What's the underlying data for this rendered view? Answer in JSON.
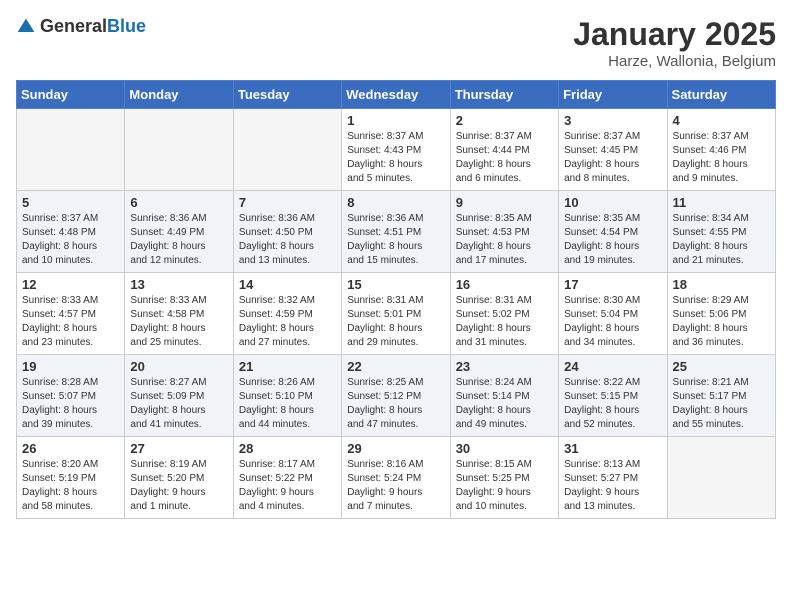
{
  "logo": {
    "text_general": "General",
    "text_blue": "Blue"
  },
  "header": {
    "month": "January 2025",
    "location": "Harze, Wallonia, Belgium"
  },
  "weekdays": [
    "Sunday",
    "Monday",
    "Tuesday",
    "Wednesday",
    "Thursday",
    "Friday",
    "Saturday"
  ],
  "weeks": [
    [
      {
        "day": "",
        "info": ""
      },
      {
        "day": "",
        "info": ""
      },
      {
        "day": "",
        "info": ""
      },
      {
        "day": "1",
        "info": "Sunrise: 8:37 AM\nSunset: 4:43 PM\nDaylight: 8 hours\nand 5 minutes."
      },
      {
        "day": "2",
        "info": "Sunrise: 8:37 AM\nSunset: 4:44 PM\nDaylight: 8 hours\nand 6 minutes."
      },
      {
        "day": "3",
        "info": "Sunrise: 8:37 AM\nSunset: 4:45 PM\nDaylight: 8 hours\nand 8 minutes."
      },
      {
        "day": "4",
        "info": "Sunrise: 8:37 AM\nSunset: 4:46 PM\nDaylight: 8 hours\nand 9 minutes."
      }
    ],
    [
      {
        "day": "5",
        "info": "Sunrise: 8:37 AM\nSunset: 4:48 PM\nDaylight: 8 hours\nand 10 minutes."
      },
      {
        "day": "6",
        "info": "Sunrise: 8:36 AM\nSunset: 4:49 PM\nDaylight: 8 hours\nand 12 minutes."
      },
      {
        "day": "7",
        "info": "Sunrise: 8:36 AM\nSunset: 4:50 PM\nDaylight: 8 hours\nand 13 minutes."
      },
      {
        "day": "8",
        "info": "Sunrise: 8:36 AM\nSunset: 4:51 PM\nDaylight: 8 hours\nand 15 minutes."
      },
      {
        "day": "9",
        "info": "Sunrise: 8:35 AM\nSunset: 4:53 PM\nDaylight: 8 hours\nand 17 minutes."
      },
      {
        "day": "10",
        "info": "Sunrise: 8:35 AM\nSunset: 4:54 PM\nDaylight: 8 hours\nand 19 minutes."
      },
      {
        "day": "11",
        "info": "Sunrise: 8:34 AM\nSunset: 4:55 PM\nDaylight: 8 hours\nand 21 minutes."
      }
    ],
    [
      {
        "day": "12",
        "info": "Sunrise: 8:33 AM\nSunset: 4:57 PM\nDaylight: 8 hours\nand 23 minutes."
      },
      {
        "day": "13",
        "info": "Sunrise: 8:33 AM\nSunset: 4:58 PM\nDaylight: 8 hours\nand 25 minutes."
      },
      {
        "day": "14",
        "info": "Sunrise: 8:32 AM\nSunset: 4:59 PM\nDaylight: 8 hours\nand 27 minutes."
      },
      {
        "day": "15",
        "info": "Sunrise: 8:31 AM\nSunset: 5:01 PM\nDaylight: 8 hours\nand 29 minutes."
      },
      {
        "day": "16",
        "info": "Sunrise: 8:31 AM\nSunset: 5:02 PM\nDaylight: 8 hours\nand 31 minutes."
      },
      {
        "day": "17",
        "info": "Sunrise: 8:30 AM\nSunset: 5:04 PM\nDaylight: 8 hours\nand 34 minutes."
      },
      {
        "day": "18",
        "info": "Sunrise: 8:29 AM\nSunset: 5:06 PM\nDaylight: 8 hours\nand 36 minutes."
      }
    ],
    [
      {
        "day": "19",
        "info": "Sunrise: 8:28 AM\nSunset: 5:07 PM\nDaylight: 8 hours\nand 39 minutes."
      },
      {
        "day": "20",
        "info": "Sunrise: 8:27 AM\nSunset: 5:09 PM\nDaylight: 8 hours\nand 41 minutes."
      },
      {
        "day": "21",
        "info": "Sunrise: 8:26 AM\nSunset: 5:10 PM\nDaylight: 8 hours\nand 44 minutes."
      },
      {
        "day": "22",
        "info": "Sunrise: 8:25 AM\nSunset: 5:12 PM\nDaylight: 8 hours\nand 47 minutes."
      },
      {
        "day": "23",
        "info": "Sunrise: 8:24 AM\nSunset: 5:14 PM\nDaylight: 8 hours\nand 49 minutes."
      },
      {
        "day": "24",
        "info": "Sunrise: 8:22 AM\nSunset: 5:15 PM\nDaylight: 8 hours\nand 52 minutes."
      },
      {
        "day": "25",
        "info": "Sunrise: 8:21 AM\nSunset: 5:17 PM\nDaylight: 8 hours\nand 55 minutes."
      }
    ],
    [
      {
        "day": "26",
        "info": "Sunrise: 8:20 AM\nSunset: 5:19 PM\nDaylight: 8 hours\nand 58 minutes."
      },
      {
        "day": "27",
        "info": "Sunrise: 8:19 AM\nSunset: 5:20 PM\nDaylight: 9 hours\nand 1 minute."
      },
      {
        "day": "28",
        "info": "Sunrise: 8:17 AM\nSunset: 5:22 PM\nDaylight: 9 hours\nand 4 minutes."
      },
      {
        "day": "29",
        "info": "Sunrise: 8:16 AM\nSunset: 5:24 PM\nDaylight: 9 hours\nand 7 minutes."
      },
      {
        "day": "30",
        "info": "Sunrise: 8:15 AM\nSunset: 5:25 PM\nDaylight: 9 hours\nand 10 minutes."
      },
      {
        "day": "31",
        "info": "Sunrise: 8:13 AM\nSunset: 5:27 PM\nDaylight: 9 hours\nand 13 minutes."
      },
      {
        "day": "",
        "info": ""
      }
    ]
  ]
}
